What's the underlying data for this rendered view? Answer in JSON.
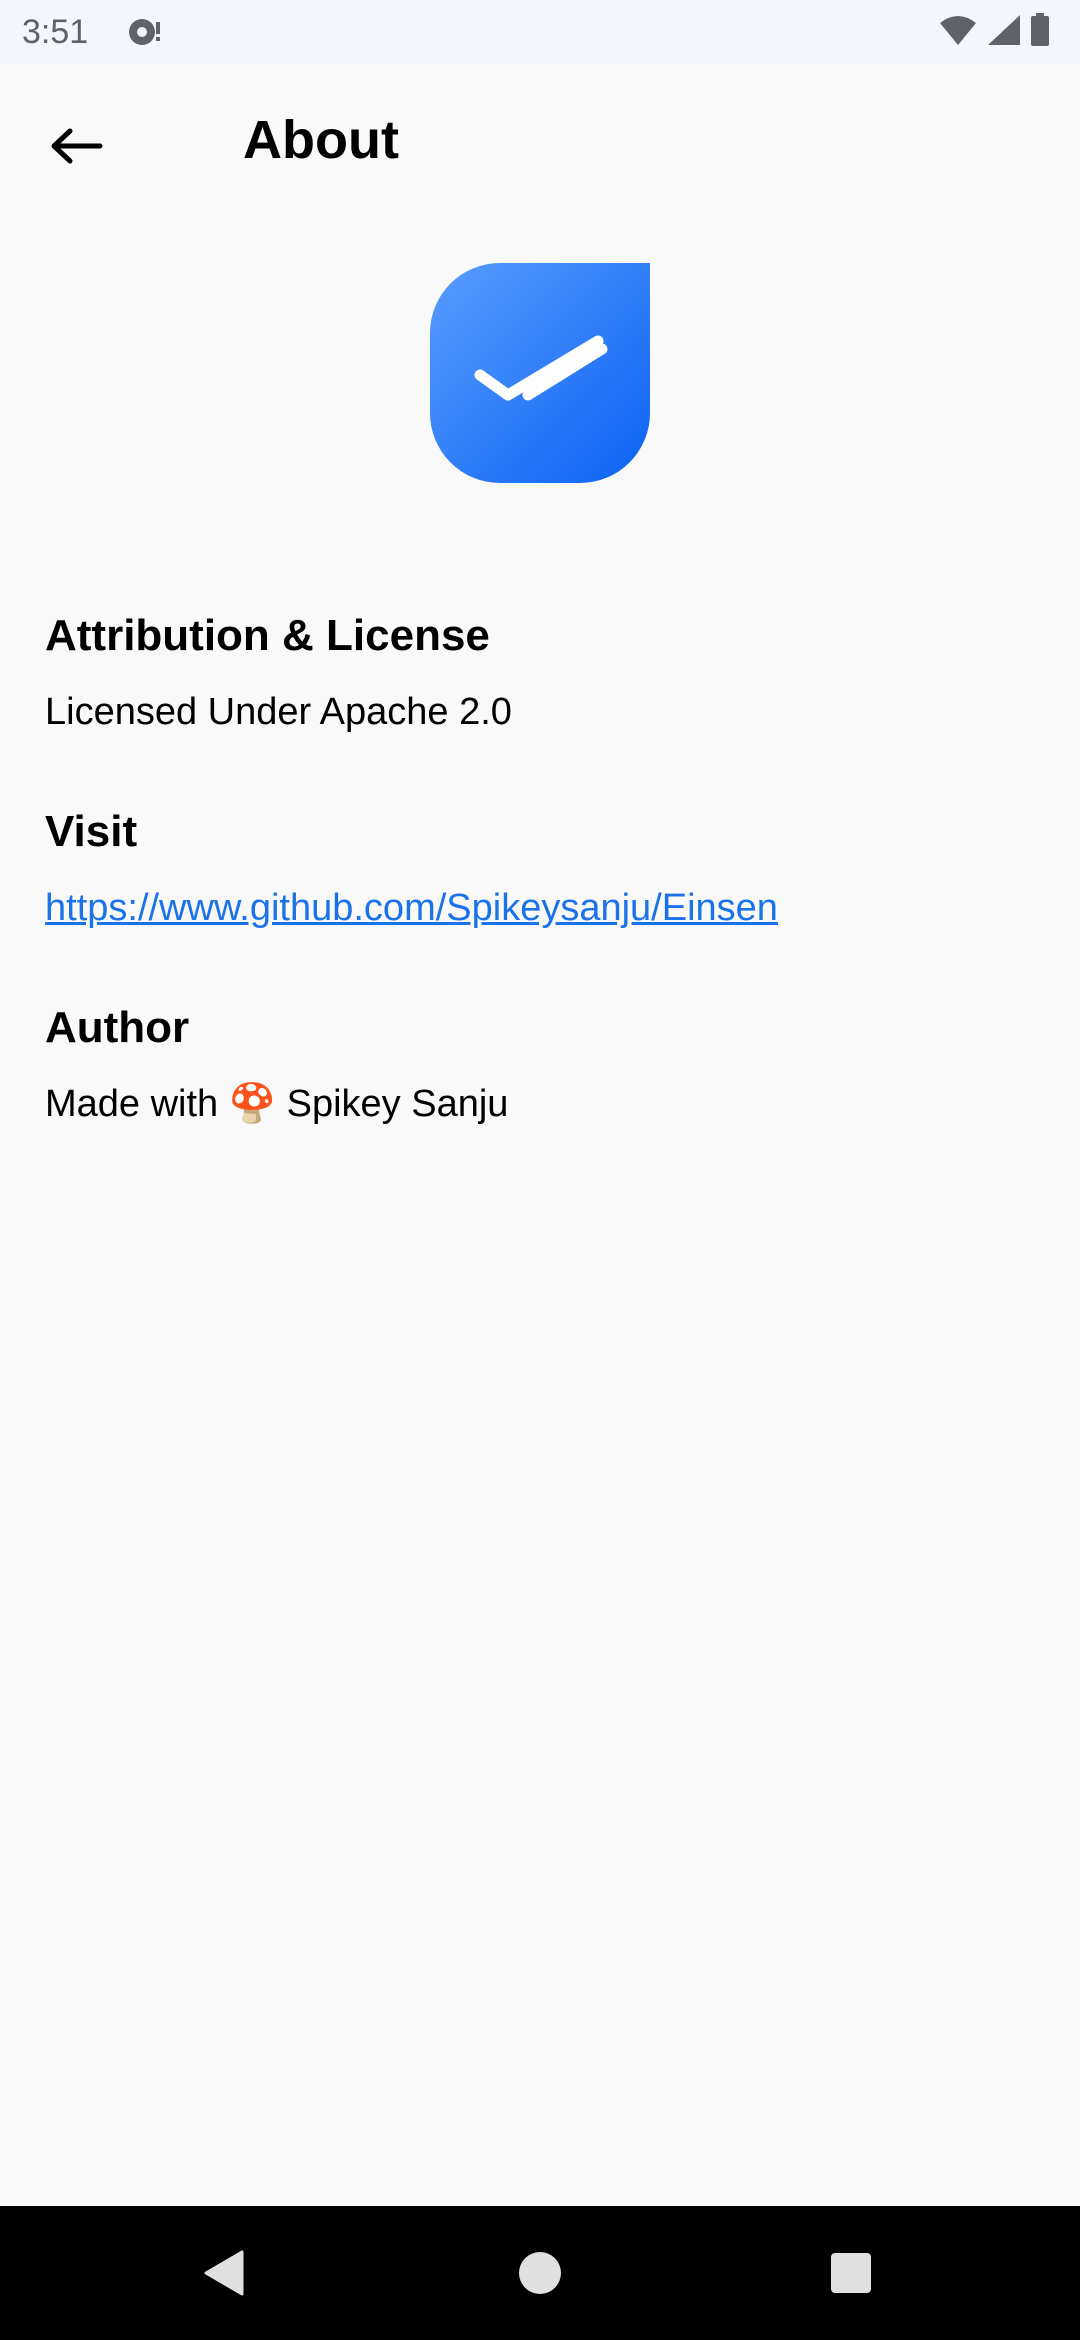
{
  "status_bar": {
    "time": "3:51",
    "icons": [
      "notification-icon",
      "wifi-icon",
      "signal-icon",
      "battery-icon"
    ]
  },
  "header": {
    "title": "About",
    "back_icon": "arrow-left-icon"
  },
  "logo": {
    "icon": "double-check-icon",
    "colors": {
      "gradient_start": "#5a9cff",
      "gradient_end": "#0a63f2"
    }
  },
  "sections": {
    "license": {
      "heading": "Attribution & License",
      "text": "Licensed Under Apache 2.0"
    },
    "visit": {
      "heading": "Visit",
      "link": "https://www.github.com/Spikeysanju/Einsen"
    },
    "author": {
      "heading": "Author",
      "text": "Made with 🍄 Spikey Sanju"
    }
  },
  "nav_bar": {
    "icons": [
      "back-triangle-icon",
      "home-circle-icon",
      "recents-square-icon"
    ]
  },
  "colors": {
    "link": "#1a73e8",
    "background": "#f9f9fa"
  }
}
